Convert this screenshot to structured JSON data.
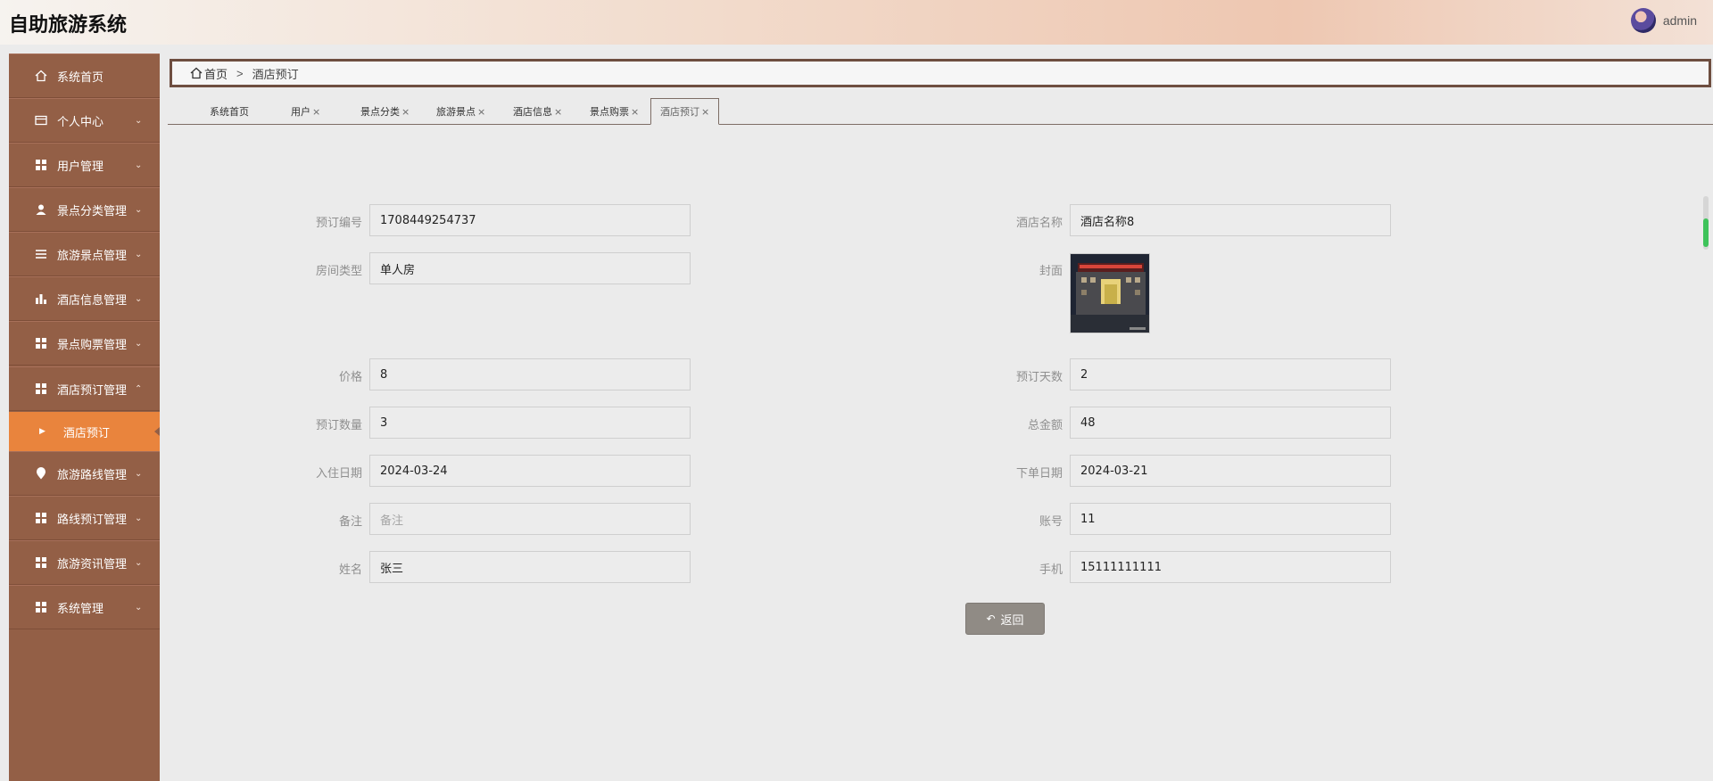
{
  "app": {
    "title": "自助旅游系统"
  },
  "user": {
    "name": "admin"
  },
  "sidebar": {
    "items": [
      {
        "label": "系统首页"
      },
      {
        "label": "个人中心"
      },
      {
        "label": "用户管理"
      },
      {
        "label": "景点分类管理"
      },
      {
        "label": "旅游景点管理"
      },
      {
        "label": "酒店信息管理"
      },
      {
        "label": "景点购票管理"
      },
      {
        "label": "酒店预订管理"
      },
      {
        "label": "旅游路线管理"
      },
      {
        "label": "路线预订管理"
      },
      {
        "label": "旅游资讯管理"
      },
      {
        "label": "系统管理"
      }
    ],
    "active_sub": "酒店预订"
  },
  "breadcrumb": {
    "home": "首页",
    "separator": ">",
    "current": "酒店预订"
  },
  "tabs": [
    {
      "label": "系统首页",
      "closable": false
    },
    {
      "label": "用户",
      "closable": true
    },
    {
      "label": "景点分类",
      "closable": true
    },
    {
      "label": "旅游景点",
      "closable": true
    },
    {
      "label": "酒店信息",
      "closable": true
    },
    {
      "label": "景点购票",
      "closable": true
    },
    {
      "label": "酒店预订",
      "closable": true
    }
  ],
  "tab_close": "×",
  "form": {
    "order_no": {
      "label": "预订编号",
      "value": "1708449254737"
    },
    "hotel_name": {
      "label": "酒店名称",
      "value": "酒店名称8"
    },
    "room_type": {
      "label": "房间类型",
      "value": "单人房"
    },
    "cover": {
      "label": "封面"
    },
    "price": {
      "label": "价格",
      "value": "8"
    },
    "days": {
      "label": "预订天数",
      "value": "2"
    },
    "quantity": {
      "label": "预订数量",
      "value": "3"
    },
    "total": {
      "label": "总金额",
      "value": "48"
    },
    "checkin_date": {
      "label": "入住日期",
      "value": "2024-03-24"
    },
    "order_date": {
      "label": "下单日期",
      "value": "2024-03-21"
    },
    "remark": {
      "label": "备注",
      "placeholder": "备注"
    },
    "account": {
      "label": "账号",
      "value": "11"
    },
    "name": {
      "label": "姓名",
      "value": "张三"
    },
    "phone": {
      "label": "手机",
      "value": "15111111111"
    }
  },
  "back_button": {
    "label": "返回"
  }
}
